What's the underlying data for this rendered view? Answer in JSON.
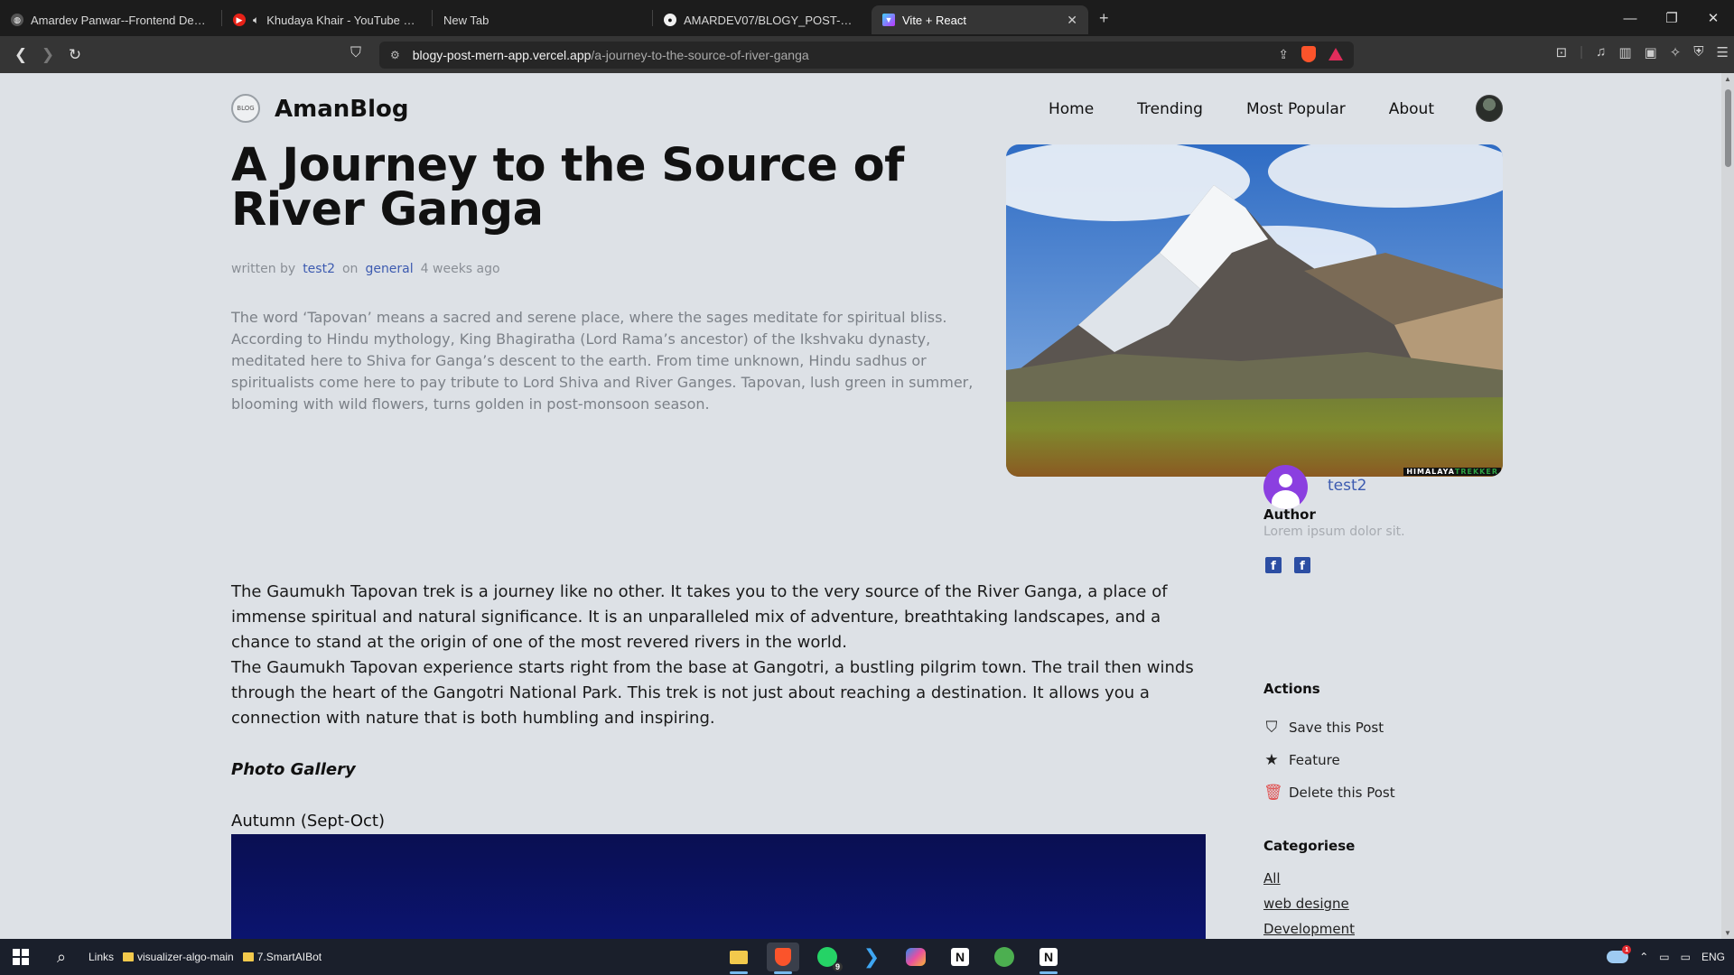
{
  "browser": {
    "tabs": [
      {
        "title": "Amardev Panwar--Frontend Developer",
        "favicon": "globe-icon",
        "active": false
      },
      {
        "title": "Khudaya Khair - YouTube Music",
        "favicon": "youtube-music-icon",
        "audio": "speaker-icon",
        "active": false
      },
      {
        "title": "New Tab",
        "favicon": "",
        "active": false
      },
      {
        "title": "AMARDEV07/BLOGY_POST-mern-app",
        "favicon": "github-icon",
        "active": false
      },
      {
        "title": "Vite + React",
        "favicon": "vite-icon",
        "active": true
      }
    ],
    "new_tab_label": "+",
    "url_host": "blogy-post-mern-app.vercel.app",
    "url_path": "/a-journey-to-the-source-of-river-ganga",
    "colors": {
      "brave": "#fb542b",
      "rewards": "#e02d5b",
      "link": "#3d5bb0"
    }
  },
  "site": {
    "logo_mark": "BLOG",
    "brand": "AmanBlog",
    "nav": [
      "Home",
      "Trending",
      "Most Popular",
      "About"
    ]
  },
  "post": {
    "title": "A Journey to the Source of River Ganga",
    "meta": {
      "written_by": "written by",
      "author": "test2",
      "on": "on",
      "category": "general",
      "time": "4 weeks ago"
    },
    "description": "The word ‘Tapovan’ means a sacred and serene place, where the sages meditate for spiritual bliss. According to Hindu mythology, King Bhagiratha (Lord Rama’s ancestor) of the Ikshvaku dynasty, meditated here to Shiva for Ganga’s descent to the earth. From time unknown, Hindu sadhus or spiritualists come here to pay tribute to Lord Shiva and River Ganges. Tapovan, lush green in summer, blooming with wild flowers, turns golden in post-monsoon season.",
    "image_watermark_a": "HIMALAYA",
    "image_watermark_b": "TREKKER",
    "body_p1": "The Gaumukh Tapovan trek is a journey like no other. It takes you to the very source of the River Ganga, a place of immense spiritual and natural significance. It is an unparalleled mix of adventure, breathtaking landscapes, and a chance to stand at the origin of one of the most revered rivers in the world.",
    "body_p2": "The Gaumukh Tapovan experience starts right from the base at Gangotri, a bustling pilgrim town. The trail then winds through the heart of the Gangotri National Park. This trek is not just about reaching a destination. It allows you a connection with nature that is both humbling and inspiring.",
    "gallery_title": "Photo Gallery",
    "season_label": "Autumn (Sept-Oct)"
  },
  "sidebar": {
    "author_heading": "Author",
    "author_name": "test2",
    "author_bio": "Lorem ipsum dolor sit.",
    "social_a": "f",
    "social_b": "f",
    "actions_heading": "Actions",
    "actions": [
      {
        "label": "Save this Post",
        "icon": "bookmark-icon"
      },
      {
        "label": "Feature",
        "icon": "star-icon"
      },
      {
        "label": "Delete this Post",
        "icon": "trash-icon"
      }
    ],
    "categories_heading": "Categoriese",
    "categories": [
      "All",
      "web designe",
      "Development"
    ]
  },
  "taskbar": {
    "links_label": "Links",
    "folders": [
      "visualizer-algo-main",
      "7.SmartAIBot"
    ],
    "whatsapp_badge": "9",
    "notion_a": "N",
    "notion_b": "N",
    "weather_badge": "1",
    "lang": "ENG"
  }
}
